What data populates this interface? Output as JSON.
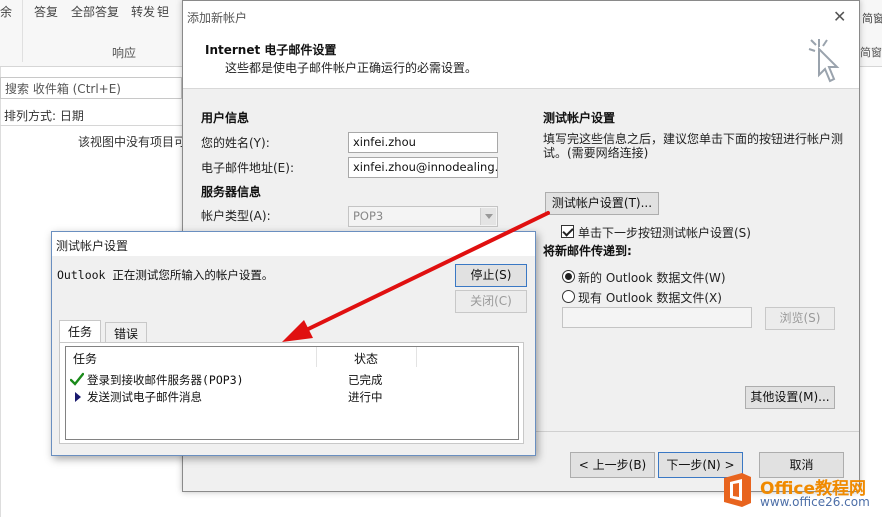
{
  "outlook": {
    "ribbon": {
      "reply": "答复",
      "reply_all": "全部答复",
      "forward": "转发",
      "group_respond": "响应",
      "right_fragment": "简窗",
      "right_group": "简窗"
    },
    "search_placeholder": "搜索 收件箱 (Ctrl+E)",
    "sort_label": "排列方式: 日期",
    "empty_message": "该视图中没有项目可"
  },
  "add_account": {
    "title": "添加新帐户",
    "header_title": "Internet 电子邮件设置",
    "header_subtitle": "这些都是使电子邮件帐户正确运行的必需设置。",
    "user_info": {
      "heading": "用户信息",
      "name_label": "您的姓名(Y):",
      "name_value": "xinfei.zhou",
      "email_label": "电子邮件地址(E):",
      "email_value": "xinfei.zhou@innodealing.com"
    },
    "server_info": {
      "heading": "服务器信息",
      "account_type_label": "帐户类型(A):",
      "account_type_value": "POP3"
    },
    "test_settings": {
      "heading": "测试帐户设置",
      "description": "填写完这些信息之后，建议您单击下面的按钮进行帐户测试。(需要网络连接)",
      "test_button": "测试帐户设置(T)...",
      "auto_test_checkbox": "单击下一步按钮测试帐户设置(S)",
      "auto_test_checked": true
    },
    "deliver_to": {
      "heading": "将新邮件传递到:",
      "option_new": "新的 Outlook 数据文件(W)",
      "option_existing": "现有 Outlook 数据文件(X)",
      "selected": "new",
      "path_value": "",
      "browse_button": "浏览(S)"
    },
    "more_settings_button": "其他设置(M)...",
    "back_button": "< 上一步(B)",
    "next_button": "下一步(N) >",
    "cancel_button": "取消"
  },
  "test_dialog": {
    "title": "测试帐户设置",
    "message": "Outlook 正在测试您所输入的帐户设置。",
    "stop_button": "停止(S)",
    "close_button": "关闭(C)",
    "tabs": [
      {
        "label": "任务",
        "active": true
      },
      {
        "label": "错误",
        "active": false
      }
    ],
    "columns": [
      "任务",
      "状态"
    ],
    "tasks": [
      {
        "task": "登录到接收邮件服务器(POP3)",
        "status": "已完成",
        "icon": "check-icon"
      },
      {
        "task": "发送测试电子邮件消息",
        "status": "进行中",
        "icon": "play-arrow-icon"
      }
    ]
  },
  "watermark": {
    "brand": "Office教程网",
    "url": "www.office26.com"
  },
  "colors": {
    "arrow": "#e01010",
    "check": "#1a8a1a",
    "brand_orange": "#f08a00",
    "brand_blue": "#4d6fa8",
    "focus_border": "#3a78c4"
  }
}
